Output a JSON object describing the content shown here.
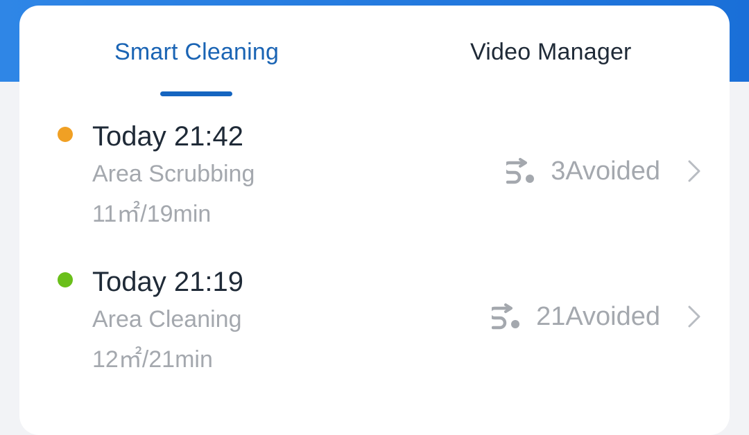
{
  "tabs": [
    {
      "label": "Smart Cleaning",
      "active": true
    },
    {
      "label": "Video Manager",
      "active": false
    }
  ],
  "colors": {
    "accent": "#1565c0",
    "header_blue": "#1a6fd8",
    "dot_orange": "#f0a024",
    "dot_green": "#6abf1a"
  },
  "records": [
    {
      "status_color": "#f0a024",
      "time": "Today 21:42",
      "mode": "Area Scrubbing",
      "stats": "11㎡/19min",
      "avoided": "3Avoided",
      "avoid_icon": "route-avoid-icon",
      "chevron_icon": "chevron-right-icon"
    },
    {
      "status_color": "#6abf1a",
      "time": "Today 21:19",
      "mode": "Area Cleaning",
      "stats": "12㎡/21min",
      "avoided": "21Avoided",
      "avoid_icon": "route-avoid-icon",
      "chevron_icon": "chevron-right-icon"
    }
  ]
}
